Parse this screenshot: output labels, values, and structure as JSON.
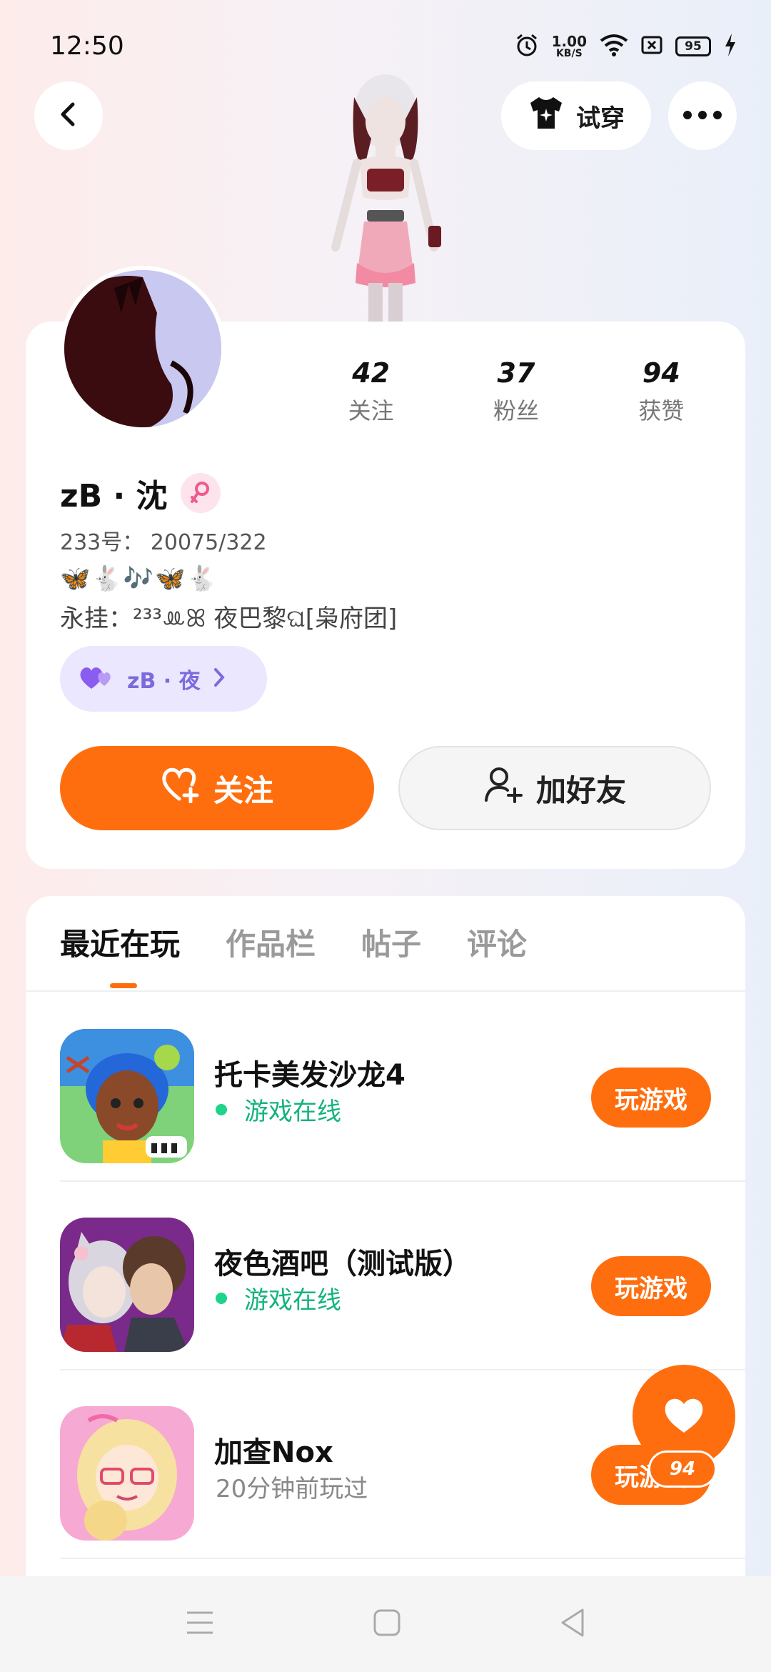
{
  "status_bar": {
    "time": "12:50",
    "speed_value": "1.00",
    "speed_unit": "KB/S",
    "battery": "95"
  },
  "header": {
    "try_on_label": "试穿"
  },
  "profile": {
    "stats": [
      {
        "num": "42",
        "label": "关注"
      },
      {
        "num": "37",
        "label": "粉丝"
      },
      {
        "num": "94",
        "label": "获赞"
      }
    ],
    "username": "zB · 沈",
    "uid": "233号：  20075/322",
    "bio_emoji": "🦋🐇🎶🦋🐇",
    "bio_text": "永挂：²³³ꔛꕤ 夜巴黎ଘ[枭府团]",
    "cp_name": "zB · 夜",
    "follow_label": "关注",
    "add_friend_label": "加好友"
  },
  "tabs": [
    {
      "label": "最近在玩",
      "active": true
    },
    {
      "label": "作品栏",
      "active": false
    },
    {
      "label": "帖子",
      "active": false
    },
    {
      "label": "评论",
      "active": false
    }
  ],
  "games": [
    {
      "title": "托卡美发沙龙4",
      "status": "游戏在线",
      "online": true,
      "play_label": "玩游戏"
    },
    {
      "title": "夜色酒吧（测试版）",
      "status": "游戏在线",
      "online": true,
      "play_label": "玩游戏"
    },
    {
      "title": "加查Nox",
      "status": "20分钟前玩过",
      "online": false,
      "play_label": "玩游戏"
    }
  ],
  "like_fab": {
    "count": "94"
  },
  "colors": {
    "accent": "#ff6e0e",
    "online": "#15b37c",
    "cp_purple": "#7b6bdc"
  }
}
